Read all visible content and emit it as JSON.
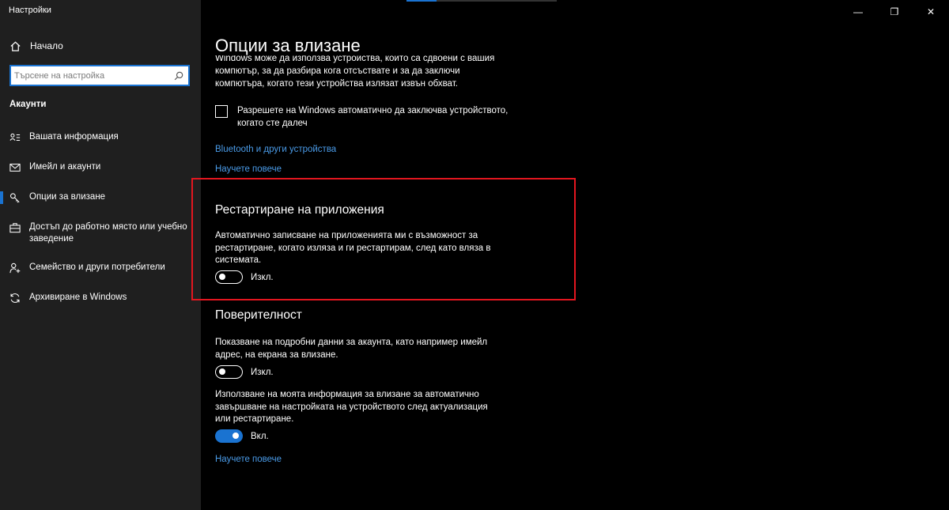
{
  "window": {
    "title": "Настройки",
    "controls": {
      "minimize": "—",
      "maximize": "❐",
      "close": "✕"
    }
  },
  "sidebar": {
    "home_label": "Начало",
    "search_placeholder": "Търсене на настройка",
    "section_title": "Акаунти",
    "items": [
      {
        "label": "Вашата информация",
        "icon": "person-card-icon",
        "active": false
      },
      {
        "label": "Имейл и акаунти",
        "icon": "mail-icon",
        "active": false
      },
      {
        "label": "Опции за влизане",
        "icon": "key-icon",
        "active": true
      },
      {
        "label": "Достъп до работно място или учебно заведение",
        "icon": "briefcase-icon",
        "active": false
      },
      {
        "label": "Семейство и други потребители",
        "icon": "person-add-icon",
        "active": false
      },
      {
        "label": "Архивиране в Windows",
        "icon": "sync-icon",
        "active": false
      }
    ]
  },
  "main": {
    "page_title": "Опции за влизане",
    "partial_text": "Windows може да използва устройства, които са сдвоени с вашия компютър, за да разбира кога отсъствате и за да заключи компютъра, когато тези устройства излязат извън обхват.",
    "dynamic_lock_checkbox": {
      "label": "Разрешете на Windows автоматично да заключва устройството, когато сте далеч",
      "checked": false
    },
    "bluetooth_link": "Bluetooth и други устройства",
    "learn_more_1": "Научете повече",
    "restart_apps": {
      "heading": "Рестартиране на приложения",
      "description": "Автоматично записване на приложенията ми с възможност за рестартиране, когато изляза и ги рестартирам, след като вляза в системата.",
      "toggle_state": "Изкл.",
      "on": false
    },
    "privacy": {
      "heading": "Поверителност",
      "account_details": {
        "description": "Показване на подробни данни за акаунта, като например имейл адрес, на екрана за влизане.",
        "toggle_state": "Изкл.",
        "on": false
      },
      "use_signin_info": {
        "description": "Използване на моята информация за влизане за автоматично завършване на настройката на устройството след актуализация или рестартиране.",
        "toggle_state": "Вкл.",
        "on": true
      },
      "learn_more": "Научете повече"
    }
  },
  "colors": {
    "accent": "#1a73d1",
    "highlight_box": "#e3161f",
    "link": "#4a9be8",
    "sidebar_bg": "#1f1f1f",
    "main_bg": "#000000"
  }
}
